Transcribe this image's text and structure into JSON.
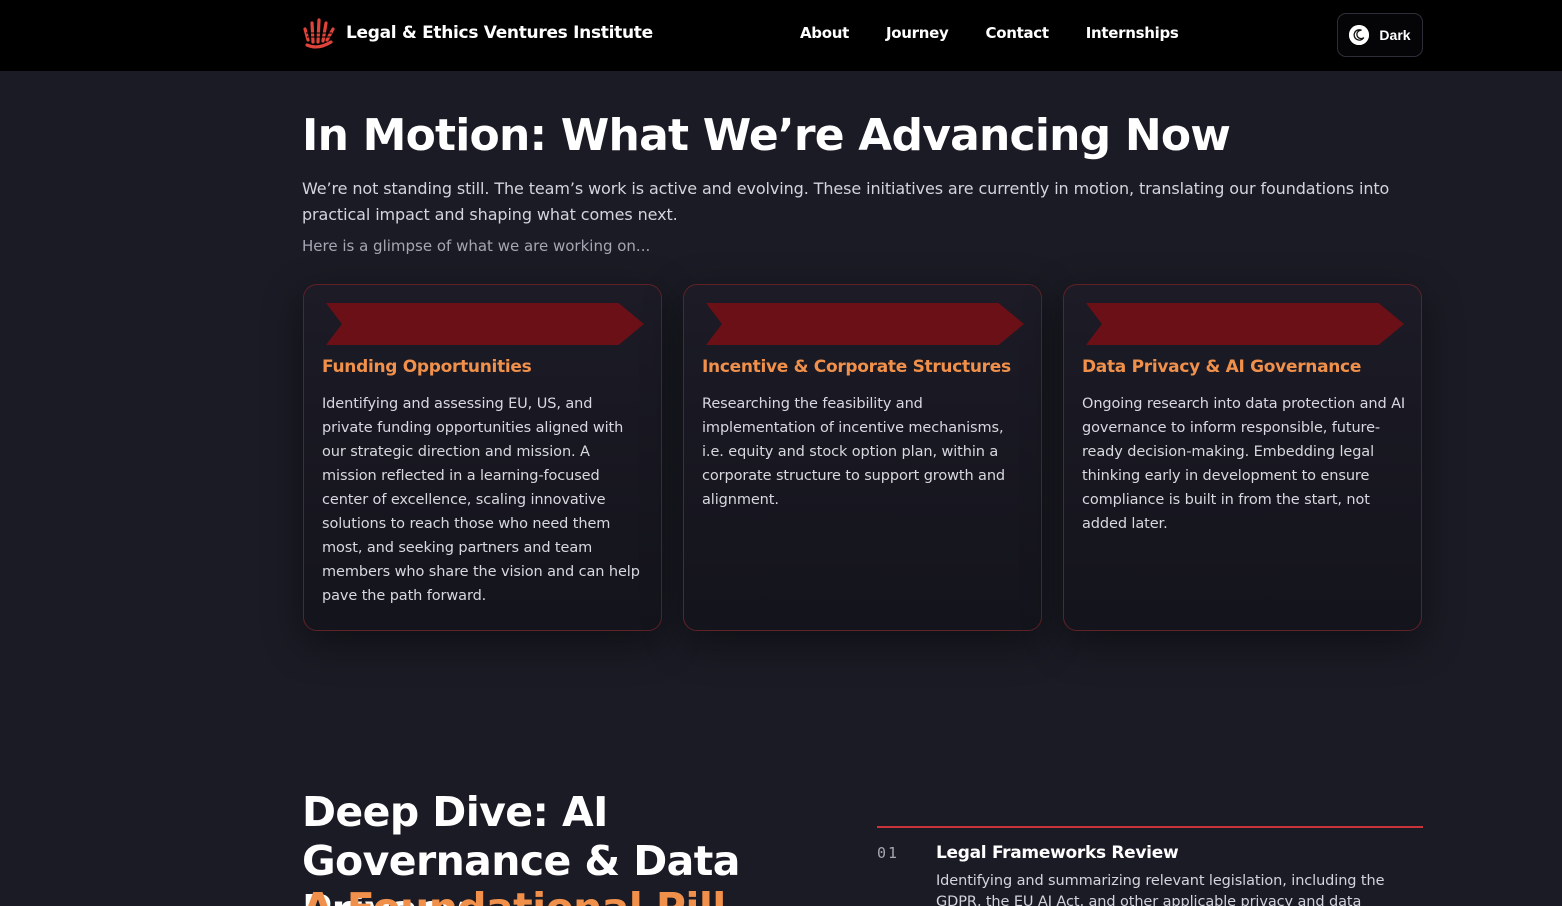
{
  "header": {
    "brand_name": "Legal & Ethics Ventures Institute",
    "logo_icon": "hand-logo-icon",
    "nav": [
      {
        "label": "About"
      },
      {
        "label": "Journey"
      },
      {
        "label": "Contact"
      },
      {
        "label": "Internships"
      }
    ],
    "theme_toggle": {
      "label": "Dark",
      "icon": "moon-icon"
    }
  },
  "in_motion": {
    "title": "In Motion: What We’re Advancing Now",
    "intro": "We’re not standing still. The team’s work is active and evolving. These initiatives are currently in motion, translating our foundations into practical impact and shaping what comes next.",
    "subtitle": "Here is a glimpse of what we are working on...",
    "cards": [
      {
        "title": "Funding Opportunities",
        "body": "Identifying and assessing EU, US, and private funding opportunities aligned with our strategic direction and mission. A mission reflected in a learning-focused center of excellence, scaling innovative solutions to reach those who need them most, and seeking partners and team members who share the vision and can help pave the path forward."
      },
      {
        "title": "Incentive & Corporate Structures",
        "body": "Researching the feasibility and implementation of incentive mechanisms, i.e. equity and stock option plan, within a corporate structure to support growth and alignment."
      },
      {
        "title": "Data Privacy & AI Governance",
        "body": "Ongoing research into data protection and AI governance to inform responsible, future-ready decision-making. Embedding legal thinking early in development to ensure compliance is built in from the start, not added later."
      }
    ]
  },
  "deep_dive": {
    "title": "Deep Dive: AI Governance & Data Privacy",
    "subtitle": "A Foundational Pill",
    "steps": [
      {
        "number": "01",
        "title": "Legal Frameworks Review",
        "body": "Identifying and summarizing relevant legislation, including the GDPR, the EU AI Act, and other applicable privacy and data governance laws."
      }
    ]
  },
  "colors": {
    "background": "#1b1b25",
    "header": "#000000",
    "accent_orange": "#f0904a",
    "ribbon_red": "#6b1016",
    "rule_red": "#c8343a"
  }
}
